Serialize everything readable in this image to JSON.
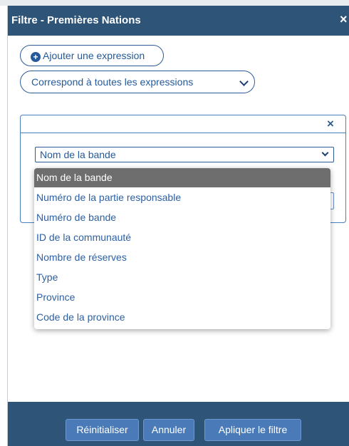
{
  "dialog": {
    "title": "Filtre - Premières Nations",
    "close_glyph": "×"
  },
  "toolbar": {
    "add_expression_label": "Ajouter une expression",
    "add_icon": "plus-circle-icon",
    "match_select_value": "Correspond à toutes les expressions"
  },
  "expression": {
    "close_glyph": "×",
    "field_select_value": "Nom de la bande",
    "value_input_value": ""
  },
  "dropdown": {
    "options": [
      "Nom de la bande",
      "Numéro de la partie responsable",
      "Numéro de bande",
      "ID de la communauté",
      "Nombre de réserves",
      "Type",
      "Province",
      "Code de la province"
    ],
    "selected_index": 0
  },
  "footer": {
    "reset_label": "Réinitialiser",
    "cancel_label": "Annuler",
    "apply_label": "Apliquer le filtre"
  },
  "colors": {
    "header_bg": "#2e5478",
    "accent": "#245a9b",
    "button_bg": "#4a7bb8",
    "selected_option_bg": "#6e6e6e"
  }
}
